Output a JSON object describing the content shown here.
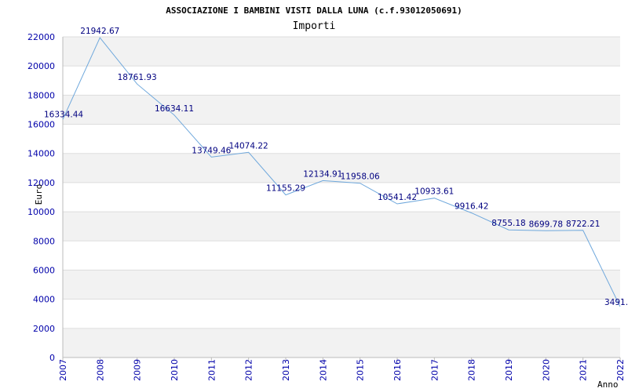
{
  "chart_data": {
    "type": "line",
    "title": "ASSOCIAZIONE I BAMBINI VISTI DALLA LUNA (c.f.93012050691)",
    "subtitle": "Importi",
    "ylabel": "Euro",
    "xlabel": "Anno",
    "x": [
      "2007",
      "2008",
      "2009",
      "2010",
      "2011",
      "2012",
      "2013",
      "2014",
      "2015",
      "2016",
      "2017",
      "2018",
      "2019",
      "2020",
      "2021",
      "2022"
    ],
    "values": [
      16334.44,
      21942.67,
      18761.93,
      16634.11,
      13749.46,
      14074.22,
      11155.29,
      12134.91,
      11958.06,
      10541.42,
      10933.61,
      9916.42,
      8755.18,
      8699.78,
      8722.21,
      3491.0
    ],
    "labels": [
      "16334.44",
      "21942.67",
      "18761.93",
      "16634.11",
      "13749.46",
      "14074.22",
      "11155.29",
      "12134.91",
      "11958.06",
      "10541.42",
      "10933.61",
      "9916.42",
      "8755.18",
      "8699.78",
      "8722.21",
      "3491.0"
    ],
    "yticks": [
      "0",
      "2000",
      "4000",
      "6000",
      "8000",
      "10000",
      "12000",
      "14000",
      "16000",
      "18000",
      "20000",
      "22000"
    ],
    "ylim": [
      0,
      22000
    ],
    "grid": true,
    "colors": {
      "line": "#6fa8dc",
      "band": "#f2f2f2",
      "gridline": "#dddddd",
      "axis": "#bbbbbb",
      "tick_text": "#0000aa",
      "label_text": "#000080"
    }
  }
}
